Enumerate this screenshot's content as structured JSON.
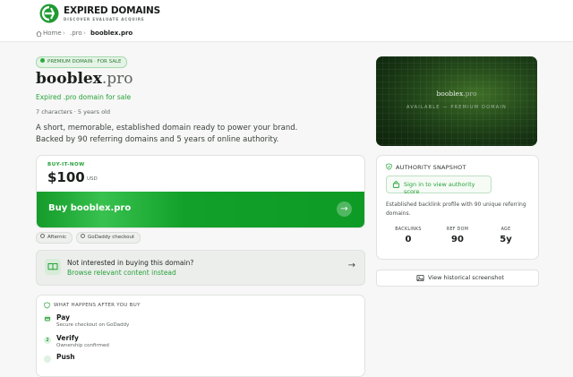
{
  "brand": {
    "name": "EXPIRED DOMAINS",
    "tagline": "DISCOVER EVALUATE ACQUIRE"
  },
  "breadcrumb": {
    "home": "Home",
    "tld": ".pro",
    "current": "booblex.pro"
  },
  "domain": {
    "badge": "PREMIUM DOMAIN · FOR SALE",
    "sld": "booblex",
    "tld": ".pro",
    "subtitle": "Expired .pro domain for sale",
    "meta": "7 characters · 5 years old",
    "description": "A short, memorable, established domain ready to power your brand. Backed by 90 referring domains and 5 years of online authority."
  },
  "buy": {
    "label": "BUY-IT-NOW",
    "price": "$100",
    "currency": "USD",
    "button_label": "Buy booblex.pro",
    "arrow": "→"
  },
  "chips": [
    "Afternic",
    "GoDaddy checkout"
  ],
  "interest": {
    "question": "Not interested in buying this domain?",
    "link": "Browse relevant content instead",
    "arrow": "→"
  },
  "steps": {
    "heading": "WHAT HAPPENS AFTER YOU BUY",
    "items": [
      {
        "num": "",
        "title": "Pay",
        "sub": "Secure checkout on GoDaddy"
      },
      {
        "num": "2",
        "title": "Verify",
        "sub": "Ownership confirmed"
      },
      {
        "num": "",
        "title": "Push",
        "sub": ""
      }
    ]
  },
  "hero": {
    "sld": "booblex",
    "tld": ".pro",
    "tag": "AVAILABLE — PREMIUM DOMAIN"
  },
  "authority": {
    "heading": "AUTHORITY SNAPSHOT",
    "signin": "Sign in to view authority score",
    "note": "Established backlink profile with 90 unique referring domains.",
    "stats": [
      {
        "label": "BACKLINKS",
        "value": "0"
      },
      {
        "label": "REF DOM",
        "value": "90"
      },
      {
        "label": "AGE",
        "value": "5y"
      }
    ]
  },
  "history_button": "View historical screenshot",
  "colors": {
    "accent": "#27a23a",
    "button": "#12a02a",
    "hero_bg": "#1a3a14"
  }
}
